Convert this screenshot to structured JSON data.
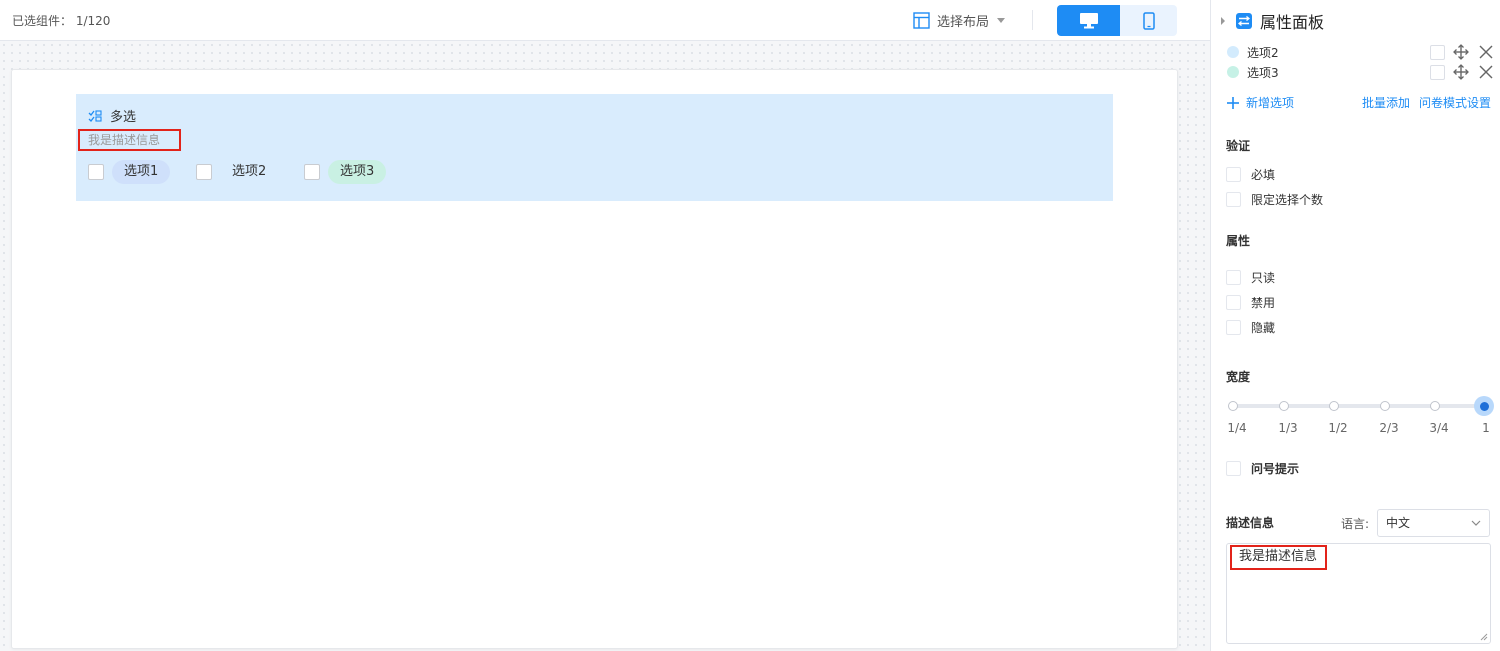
{
  "header": {
    "selected_label": "已选组件：",
    "selected_count": "1/120",
    "layout_select_label": "选择布局"
  },
  "device_toggle": {
    "active": "desktop",
    "icons": [
      "desktop-icon",
      "mobile-icon"
    ]
  },
  "field": {
    "icon": "multi-select-icon",
    "title": "多选",
    "description": "我是描述信息",
    "options": [
      {
        "label": "选项1",
        "color": "#cfe0fb"
      },
      {
        "label": "选项2",
        "color": "#d9ecfd"
      },
      {
        "label": "选项3",
        "color": "#c9f0e3"
      }
    ]
  },
  "panel": {
    "title": "属性面板",
    "options": [
      {
        "label": "选项2",
        "color": "#d3ebfd"
      },
      {
        "label": "选项3",
        "color": "#c6f1e6"
      }
    ],
    "add_option": "新增选项",
    "batch_add": "批量添加",
    "survey_mode": "问卷模式设置",
    "validation": {
      "title": "验证",
      "items": [
        "必填",
        "限定选择个数"
      ]
    },
    "attributes": {
      "title": "属性",
      "items": [
        "只读",
        "禁用",
        "隐藏"
      ]
    },
    "width": {
      "title": "宽度",
      "marks": [
        "1/4",
        "1/3",
        "1/2",
        "2/3",
        "3/4",
        "1"
      ],
      "value": "1"
    },
    "question_hint": "问号提示",
    "description": {
      "label": "描述信息",
      "lang_label": "语言:",
      "lang_value": "中文",
      "text": "我是描述信息"
    }
  },
  "colors": {
    "accent": "#1e8cf4",
    "selection": "#d9ecfd",
    "highlight_border": "#e2231a"
  }
}
